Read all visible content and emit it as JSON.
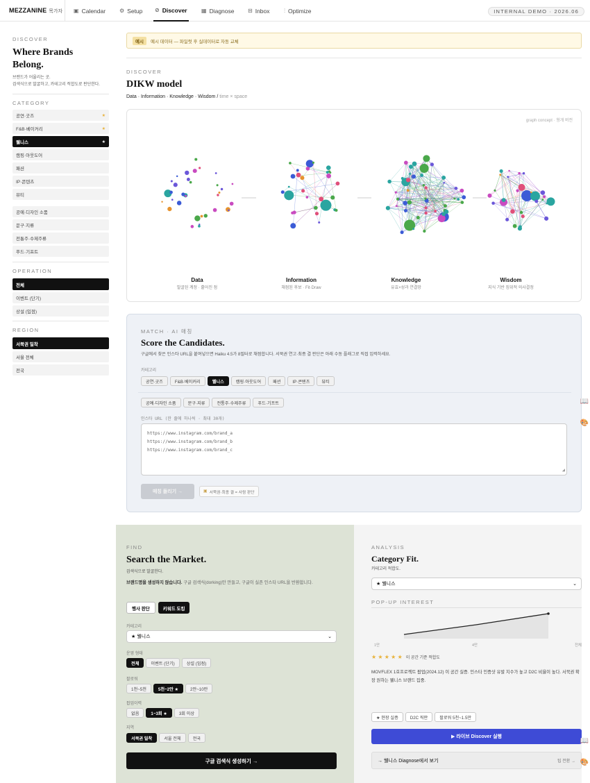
{
  "topbar": {
    "logo": "MEZZANINE",
    "logo_sub": "목가자",
    "nav": [
      {
        "icon": "calendar-icon",
        "glyph": "▣",
        "label": "Calendar"
      },
      {
        "icon": "gear-icon",
        "glyph": "⚙",
        "label": "Setup"
      },
      {
        "icon": "compass-icon",
        "glyph": "⊘",
        "label": "Discover"
      },
      {
        "icon": "grid-icon",
        "glyph": "▦",
        "label": "Diagnose"
      },
      {
        "icon": "inbox-icon",
        "glyph": "⊟",
        "label": "Inbox"
      },
      {
        "icon": "sliders-icon",
        "glyph": "⫶",
        "label": "Optimize"
      }
    ],
    "demo_badge": "INTERNAL DEMO · 2026.06"
  },
  "sidebar": {
    "section": "DISCOVER",
    "title_line1": "Where Brands",
    "title_line2": "Belong.",
    "desc_line1": "브랜드가 어울리는 곳.",
    "desc_line2": "검색식으로 발굴하고, 카테고리 적합도로 판단한다.",
    "category_label": "CATEGORY",
    "categories": [
      {
        "label": "공연·굿즈",
        "star": "★"
      },
      {
        "label": "F&B·베이커리",
        "star": "★"
      },
      {
        "label": "웰니스",
        "star": "★"
      },
      {
        "label": "캠핑·아웃도어",
        "star": ""
      },
      {
        "label": "패션",
        "star": ""
      },
      {
        "label": "IP·콘텐츠",
        "star": ""
      },
      {
        "label": "뷰티",
        "star": ""
      }
    ],
    "categories2": [
      "공예·디자인 소품",
      "문구·지류",
      "전통주·수제주류",
      "푸드·기프트"
    ],
    "operation_label": "OPERATION",
    "operations": [
      "전체",
      "이벤트 (단기)",
      "상설 (입점)"
    ],
    "region_label": "REGION",
    "regions": [
      "서북권 밀착",
      "서울 전체",
      "전국"
    ]
  },
  "notice": {
    "tag": "예시",
    "text": "예시 데이터 — 파일럿 후 실데이터로 자동 교체"
  },
  "dikw": {
    "section": "DISCOVER",
    "title": "DIKW model",
    "subtitle_bold": "Data · Information · Knowledge · Wisdom /",
    "subtitle_light": " time × space",
    "concept_note": "graph concept · 형개 버전",
    "stages": [
      {
        "name": "Data",
        "desc": "발굴된 계정 · 흩어진 점"
      },
      {
        "name": "Information",
        "desc": "채점된 후보 · Fit·Draw"
      },
      {
        "name": "Knowledge",
        "desc": "유효×성과 연결망"
      },
      {
        "name": "Wisdom",
        "desc": "지식 기반 징위적 의사결정"
      }
    ]
  },
  "match": {
    "section": "MATCH · AI 매칭",
    "title": "Score the Candidates.",
    "desc": "구글에서 찾은 인스타 URL을 붙여넣으면 Haiku 4.5가 8필터로 채점합니다. 서북권 연고·최종 결 판단은 아래 수동 플래그로 직접 입력하세요.",
    "category_label": "카테고리",
    "chips1": [
      "공연·굿즈",
      "F&B·베이커리",
      "웰니스",
      "캠핑·아웃도어",
      "패션",
      "IP·콘텐츠",
      "뷰티"
    ],
    "chips2": [
      "공예·디자인 소품",
      "문구·지류",
      "전통주·수제주류",
      "푸드·기프트"
    ],
    "url_label": "인스타 URL (한 줄에 하나씩 · 최대 30개)",
    "url_lines": [
      "https://www.instagram.com/brand_a",
      "https://www.instagram.com/brand_b",
      "https://www.instagram.com/brand_c"
    ],
    "button": "매칭 돌리기 →",
    "hint": "서북권·최종 결 = 사람 판단"
  },
  "find": {
    "section": "FIND",
    "title": "Search the Market.",
    "sub": "검색식으로 발굴한다.",
    "desc_bold": "브랜드명을 생성하지 않습니다.",
    "desc_rest": " 구글 검색식(dorking)만 만들고, 구글이 실존 인스타 URL을 반환합니다.",
    "modes": [
      "행사 판단",
      "키워드 도킹"
    ],
    "category_label": "카테고리",
    "category_value": "★ 웰니스",
    "op_label": "운영 형태",
    "ops": [
      "전체",
      "이벤트 (단기)",
      "상설 (입점)"
    ],
    "follower_label": "팔로워",
    "followers": [
      "1천~5천",
      "5천~2만 ★",
      "2만~10만"
    ],
    "popup_label": "팝업이력",
    "popups": [
      "없음",
      "1~3회 ★",
      "3회 이상"
    ],
    "region_label": "지역",
    "regions": [
      "서북권 밀착",
      "서울 전체",
      "전국"
    ],
    "cta": "구글 검색식 생성하기 →"
  },
  "analysis": {
    "section": "ANALYSIS",
    "title": "Category Fit.",
    "sub": "카테고리 적합도.",
    "select_value": "★ 웰니스",
    "interest_label": "POP-UP INTEREST",
    "chart_axis": [
      "1만",
      "4만",
      "전체"
    ],
    "stars": "★ ★ ★ ★ ★",
    "stars_note": "이 공간 기준 적합도",
    "desc": "MOVFLEX 1호프로젝트 팝업(2024.12) 이 공간 실증. 인스타 인증샷 유발 지수가 높고 D2C 비율이 높다. 서북권 확장 원하는 웰니스 브랜드 집중.",
    "tags": [
      "★ 현장 실증",
      "D2C 직판",
      "팔로워 5천~1.5만"
    ],
    "primary_button": "▶ 라이브 Discover 실행",
    "secondary_label": "→ 웰니스 Diagnose에서 보기",
    "secondary_right": "팁 전환 →"
  },
  "chart_data": {
    "type": "area",
    "x": [
      "1만",
      "4만",
      "전체"
    ],
    "series": [
      {
        "values": [
          0.15,
          0.5,
          0.9
        ]
      }
    ],
    "color": "#222222"
  }
}
